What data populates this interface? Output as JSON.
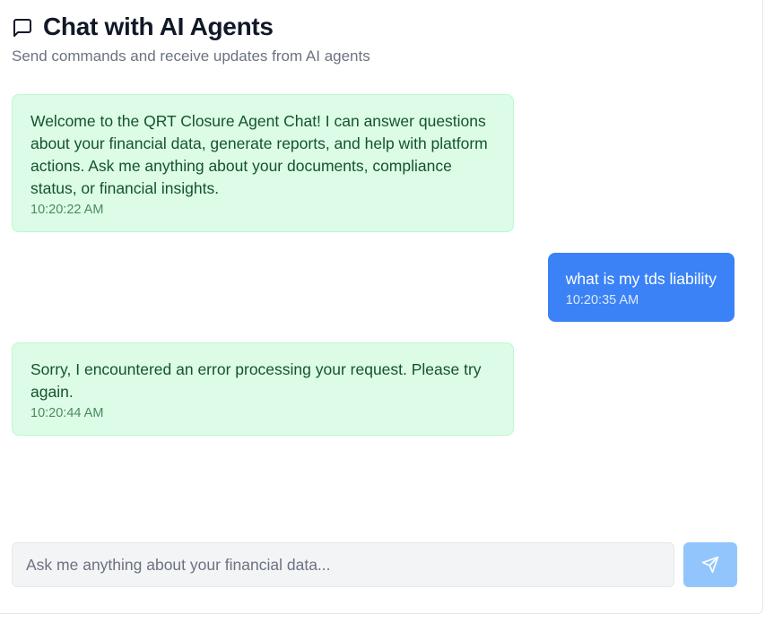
{
  "header": {
    "title": "Chat with AI Agents",
    "subtitle": "Send commands and receive updates from AI agents",
    "icon": "message-square-icon"
  },
  "messages": [
    {
      "role": "agent",
      "text": "Welcome to the QRT Closure Agent Chat! I can answer questions about your financial data, generate reports, and help with platform actions. Ask me anything about your documents, compliance status, or financial insights.",
      "time": "10:20:22 AM"
    },
    {
      "role": "user",
      "text": "what is my tds liability",
      "time": "10:20:35 AM"
    },
    {
      "role": "agent",
      "text": "Sorry, I encountered an error processing your request. Please try again.",
      "time": "10:20:44 AM"
    }
  ],
  "input": {
    "placeholder": "Ask me anything about your financial data...",
    "value": ""
  },
  "send_button": {
    "icon": "send-icon"
  },
  "colors": {
    "agent_bubble": "#dcfce7",
    "agent_text": "#14532d",
    "user_bubble": "#3b82f6",
    "send_button_disabled": "#93c5fd"
  }
}
